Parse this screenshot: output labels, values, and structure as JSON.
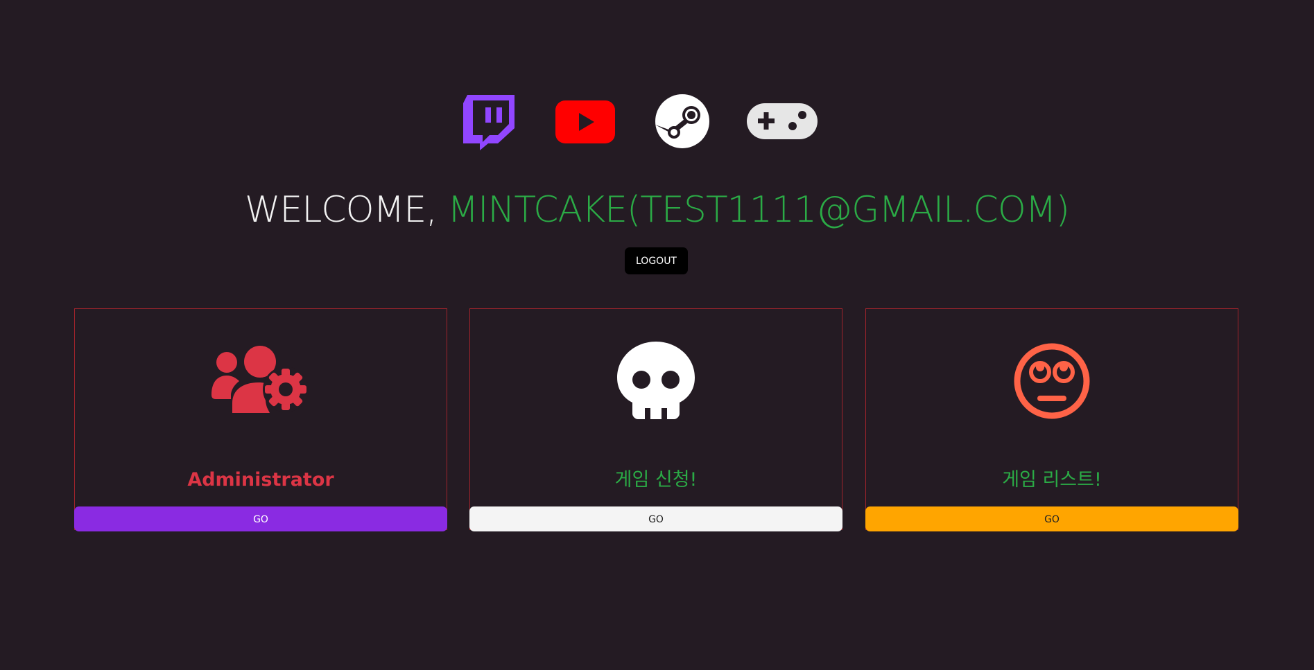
{
  "social": [
    {
      "name": "twitch",
      "icon": "twitch-icon",
      "color": "#9146ff"
    },
    {
      "name": "youtube",
      "icon": "youtube-icon",
      "color": "#ff0000"
    },
    {
      "name": "steam",
      "icon": "steam-icon",
      "color": "#ffffff"
    },
    {
      "name": "gamepad",
      "icon": "gamepad-icon",
      "color": "#e6e6e6"
    }
  ],
  "header": {
    "welcome_prefix": "WELCOME, ",
    "username": "MINTCAKE(TEST1111@GMAIL.COM)",
    "logout_label": "LOGOUT"
  },
  "cards": [
    {
      "title": "Administrator",
      "icon": "users-gear-icon",
      "go_label": "GO",
      "accent": "#dc3545",
      "button_color": "#8a2be2"
    },
    {
      "title": "게임 신청!",
      "icon": "skull-icon",
      "go_label": "GO",
      "accent": "#2bab46",
      "button_color": "#f4f4f4"
    },
    {
      "title": "게임 리스트!",
      "icon": "face-rolling-eyes-icon",
      "go_label": "GO",
      "accent": "#2bab46",
      "button_color": "#ffa500"
    }
  ],
  "colors": {
    "background": "#241b23",
    "card_border": "#a0242c",
    "username": "#2bab46"
  }
}
